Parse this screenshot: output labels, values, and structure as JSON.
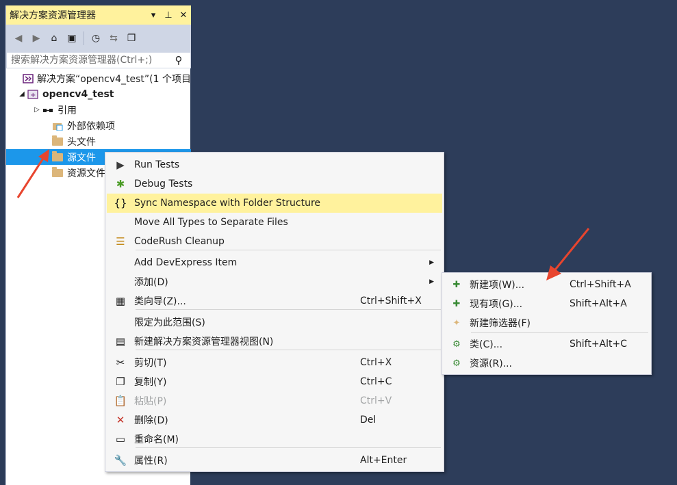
{
  "panel": {
    "title": "解决方案资源管理器",
    "title_buttons": [
      "▾",
      "⊥",
      "✕"
    ],
    "search_placeholder": "搜索解决方案资源管理器(Ctrl+;)"
  },
  "tree": [
    {
      "label": "解决方案“opencv4_test”(1 个项目",
      "indent": 16,
      "expander": "",
      "icon": "solution-icon",
      "bold": false,
      "selected": false
    },
    {
      "label": "opencv4_test",
      "indent": 16,
      "expander": "◢",
      "icon": "project-icon",
      "bold": true,
      "selected": false
    },
    {
      "label": "引用",
      "indent": 38,
      "expander": "▷",
      "icon": "references-icon",
      "bold": false,
      "selected": false
    },
    {
      "label": "外部依赖项",
      "indent": 52,
      "expander": "",
      "icon": "external-dependencies-icon",
      "bold": false,
      "selected": false
    },
    {
      "label": "头文件",
      "indent": 52,
      "expander": "",
      "icon": "folder-icon",
      "bold": false,
      "selected": false
    },
    {
      "label": "源文件",
      "indent": 52,
      "expander": "",
      "icon": "folder-icon",
      "bold": false,
      "selected": true
    },
    {
      "label": "资源文件",
      "indent": 52,
      "expander": "",
      "icon": "folder-icon",
      "bold": false,
      "selected": false
    }
  ],
  "context_menu": {
    "items": [
      {
        "label": "Run Tests",
        "shortcut": "",
        "icon": "run-tests-icon",
        "glyph": "▶",
        "color": "#3c3c3c",
        "hover": false,
        "disabled": false,
        "submenu": false
      },
      {
        "label": "Debug Tests",
        "shortcut": "",
        "icon": "debug-bug-icon",
        "glyph": "✱",
        "color": "#4a9b25",
        "hover": false,
        "disabled": false,
        "submenu": false
      },
      {
        "label": "Sync Namespace with Folder Structure",
        "shortcut": "",
        "icon": "namespace-icon",
        "glyph": "{}",
        "color": "#1e1e1e",
        "hover": true,
        "disabled": false,
        "submenu": false
      },
      {
        "label": "Move All Types to Separate Files",
        "shortcut": "",
        "icon": "",
        "glyph": "",
        "color": "#1e1e1e",
        "hover": false,
        "disabled": false,
        "submenu": false
      },
      {
        "label": "CodeRush Cleanup",
        "shortcut": "",
        "icon": "cleanup-broom-icon",
        "glyph": "☰",
        "color": "#c48b1c",
        "hover": false,
        "disabled": false,
        "submenu": false
      },
      {
        "label": "Add DevExpress Item",
        "shortcut": "",
        "icon": "",
        "glyph": "",
        "color": "#1e1e1e",
        "hover": false,
        "disabled": false,
        "submenu": true
      },
      {
        "label": "添加(D)",
        "shortcut": "",
        "icon": "",
        "glyph": "",
        "color": "#1e1e1e",
        "hover": false,
        "disabled": false,
        "submenu": true
      },
      {
        "label": "类向导(Z)...",
        "shortcut": "Ctrl+Shift+X",
        "icon": "class-wizard-icon",
        "glyph": "▦",
        "color": "#1e1e1e",
        "hover": false,
        "disabled": false,
        "submenu": false
      },
      {
        "label": "限定为此范围(S)",
        "shortcut": "",
        "icon": "",
        "glyph": "",
        "color": "#1e1e1e",
        "hover": false,
        "disabled": false,
        "submenu": false
      },
      {
        "label": "新建解决方案资源管理器视图(N)",
        "shortcut": "",
        "icon": "new-view-icon",
        "glyph": "▤",
        "color": "#1e1e1e",
        "hover": false,
        "disabled": false,
        "submenu": false
      },
      {
        "label": "剪切(T)",
        "shortcut": "Ctrl+X",
        "icon": "cut-scissors-icon",
        "glyph": "✂",
        "color": "#1e1e1e",
        "hover": false,
        "disabled": false,
        "submenu": false
      },
      {
        "label": "复制(Y)",
        "shortcut": "Ctrl+C",
        "icon": "copy-icon",
        "glyph": "❐",
        "color": "#1e1e1e",
        "hover": false,
        "disabled": false,
        "submenu": false
      },
      {
        "label": "粘贴(P)",
        "shortcut": "Ctrl+V",
        "icon": "paste-icon",
        "glyph": "📋",
        "color": "#a2a4a5",
        "hover": false,
        "disabled": true,
        "submenu": false
      },
      {
        "label": "删除(D)",
        "shortcut": "Del",
        "icon": "delete-x-icon",
        "glyph": "✕",
        "color": "#c5362b",
        "hover": false,
        "disabled": false,
        "submenu": false
      },
      {
        "label": "重命名(M)",
        "shortcut": "",
        "icon": "rename-icon",
        "glyph": "▭",
        "color": "#1e1e1e",
        "hover": false,
        "disabled": false,
        "submenu": false
      },
      {
        "label": "属性(R)",
        "shortcut": "Alt+Enter",
        "icon": "properties-wrench-icon",
        "glyph": "🔧",
        "color": "#1e1e1e",
        "hover": false,
        "disabled": false,
        "submenu": false
      }
    ]
  },
  "submenu": {
    "items": [
      {
        "label": "新建项(W)...",
        "shortcut": "Ctrl+Shift+A",
        "icon": "new-item-icon",
        "glyph": "✚"
      },
      {
        "label": "现有项(G)...",
        "shortcut": "Shift+Alt+A",
        "icon": "existing-item-icon",
        "glyph": "✚"
      },
      {
        "label": "新建筛选器(F)",
        "shortcut": "",
        "icon": "new-filter-icon",
        "glyph": "✦"
      },
      {
        "label": "类(C)...",
        "shortcut": "Shift+Alt+C",
        "icon": "class-icon",
        "glyph": "⚙"
      },
      {
        "label": "资源(R)...",
        "shortcut": "",
        "icon": "resource-icon",
        "glyph": "⚙"
      }
    ]
  },
  "colors": {
    "title_highlight": "#fff29d",
    "selection": "#1c97ea",
    "annotation_arrow": "#e8452e"
  }
}
